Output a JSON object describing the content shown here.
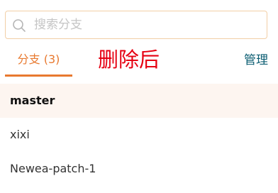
{
  "search": {
    "placeholder": "搜索分支"
  },
  "tabs": {
    "branches_label": "分支 (3)",
    "manage_label": "管理"
  },
  "annotation": "删除后",
  "colors": {
    "accent": "#e8792f",
    "annotation": "#e60012",
    "link": "#0b5d72",
    "current_row_bg": "#fdf5f0"
  },
  "branches": [
    {
      "name": "master",
      "current": true
    },
    {
      "name": "xixi",
      "current": false
    },
    {
      "name": "Newea-patch-1",
      "current": false
    }
  ]
}
